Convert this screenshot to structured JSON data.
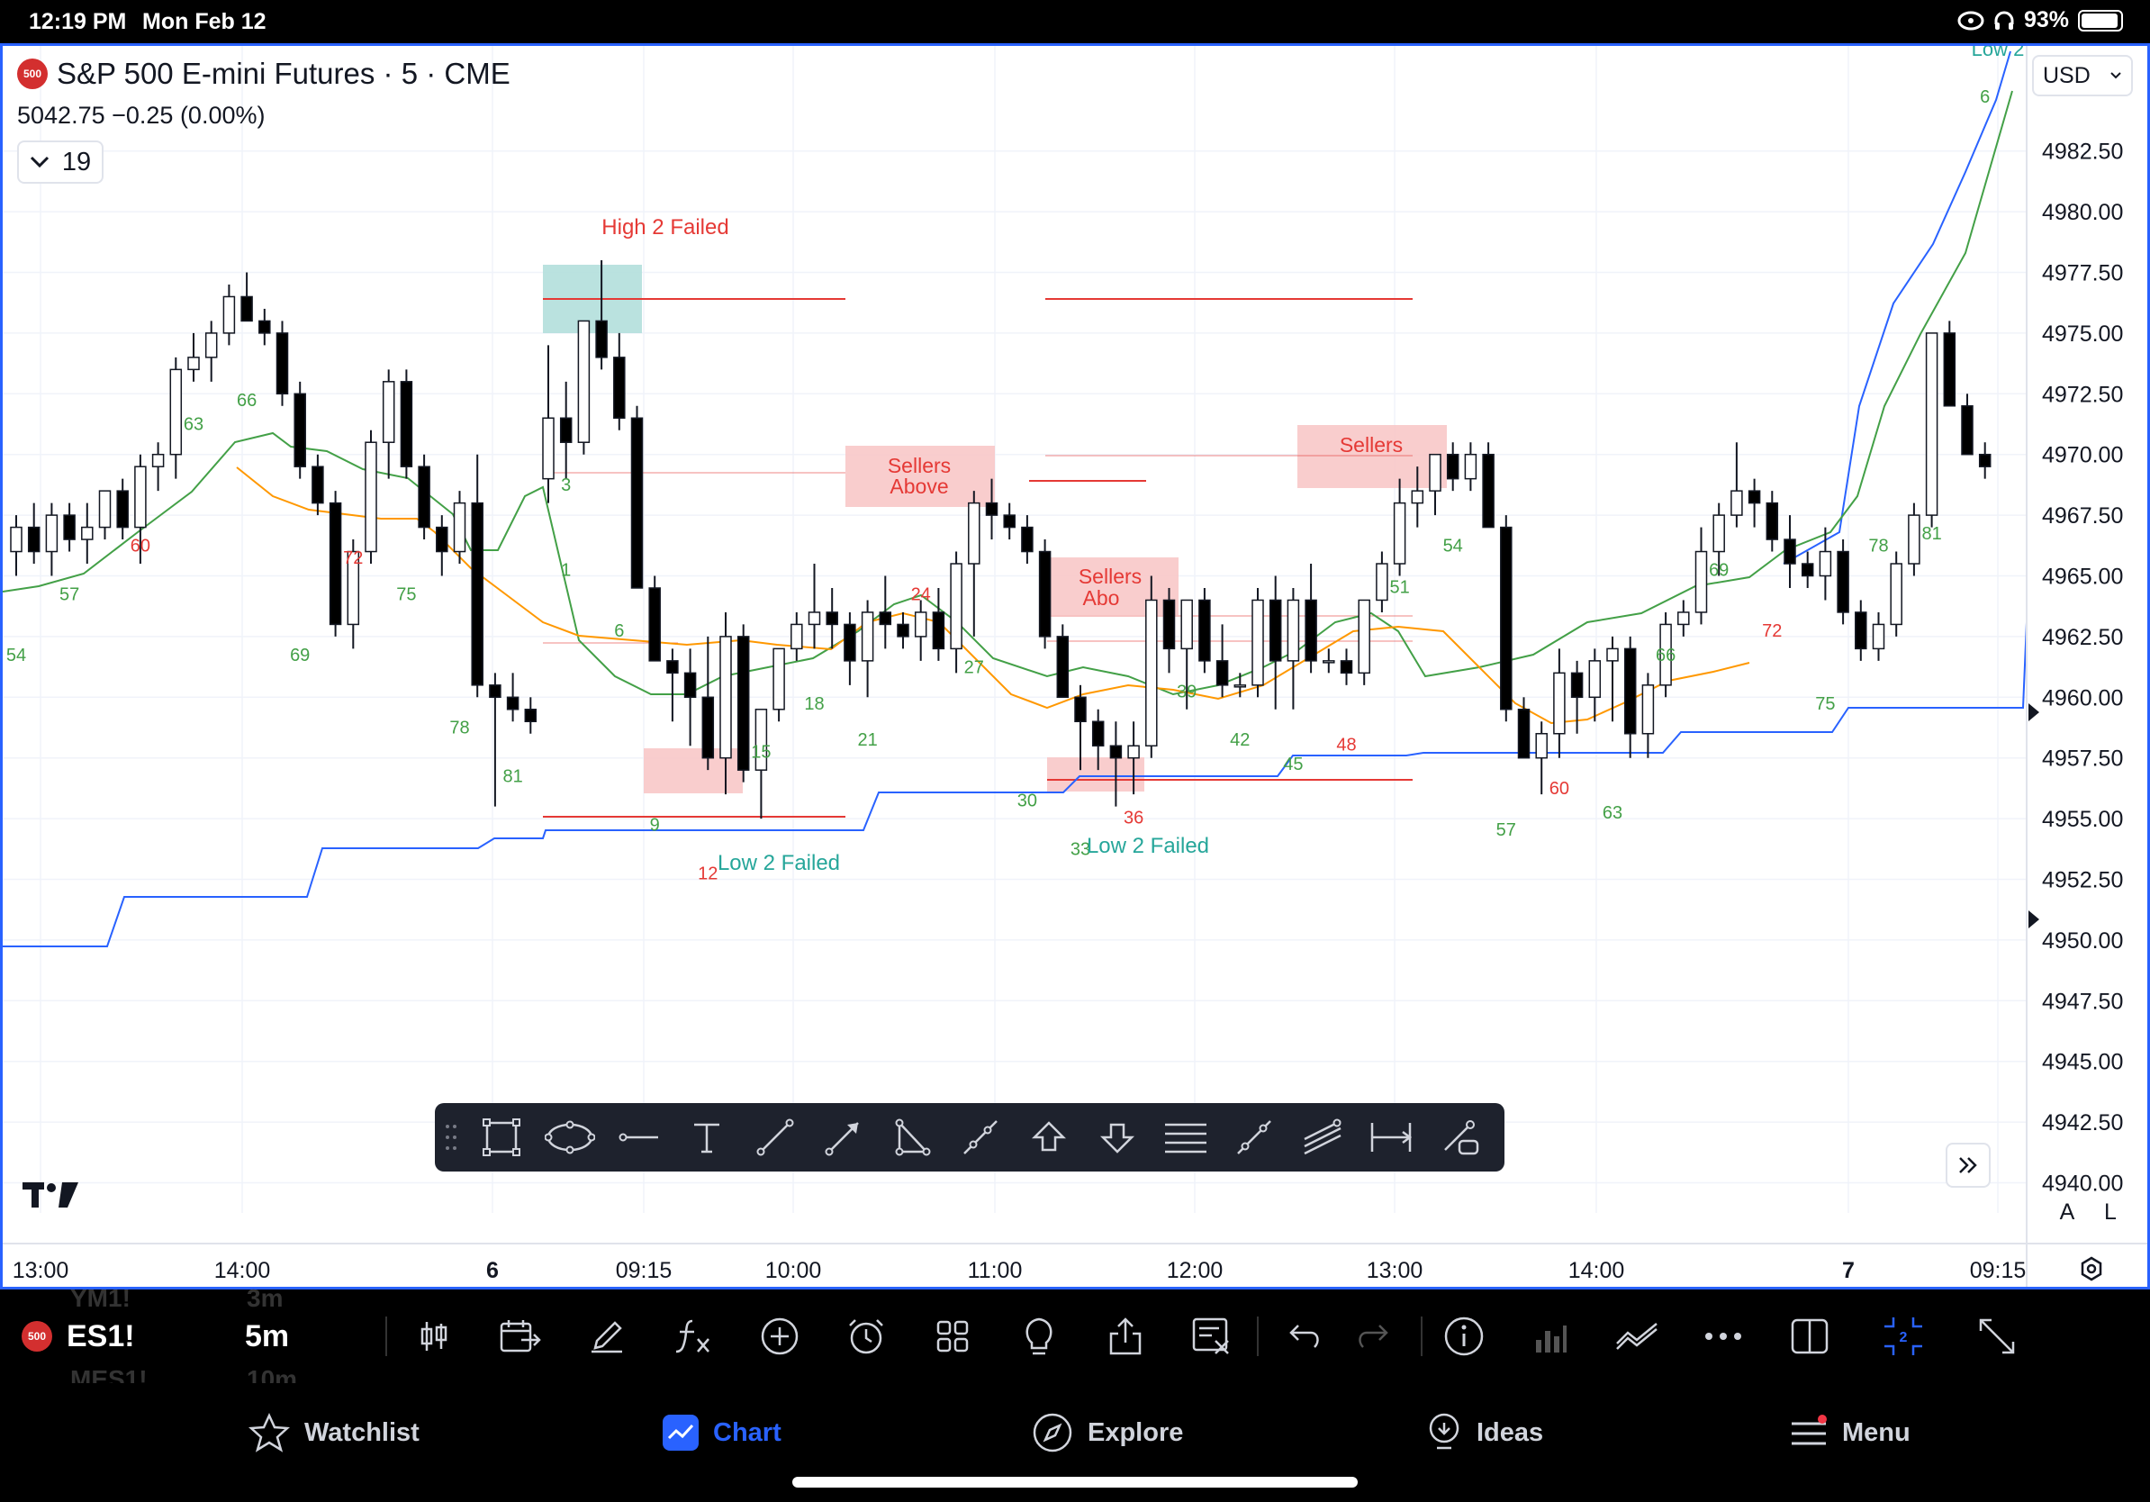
{
  "status": {
    "time": "12:19 PM",
    "date": "Mon Feb 12",
    "battery": "93%"
  },
  "header": {
    "symbol_badge": "500",
    "title": "S&P 500 E-mini Futures · 5 · CME",
    "last": "5042.75",
    "change": "−0.25 (0.00%)",
    "legend_count": "19",
    "currency": "USD"
  },
  "annotations": {
    "high2": "High 2 Failed",
    "sellers": "Sellers",
    "above": "Above",
    "sellers_above_short": "Abo",
    "low2": "Low 2 Failed",
    "low2_edge": "Low 2"
  },
  "chart_data": {
    "type": "candlestick",
    "instrument": "ES1!",
    "interval": "5m",
    "ylim": [
      4938.5,
      4987.5
    ],
    "price_ticks": [
      "4982.50",
      "4980.00",
      "4977.50",
      "4975.00",
      "4972.50",
      "4970.00",
      "4967.50",
      "4965.00",
      "4962.50",
      "4960.00",
      "4957.50",
      "4955.00",
      "4952.50",
      "4950.00",
      "4947.50",
      "4945.00",
      "4942.50",
      "4940.00"
    ],
    "time_ticks": [
      "13:00",
      "14:00",
      "6",
      "09:15",
      "10:00",
      "11:00",
      "12:00",
      "13:00",
      "14:00",
      "7",
      "09:15"
    ],
    "candles": [
      [
        0,
        4966,
        4967.5,
        4965,
        4967
      ],
      [
        1,
        4967,
        4968,
        4965.5,
        4966
      ],
      [
        2,
        4966,
        4968,
        4965,
        4967.5
      ],
      [
        3,
        4967.5,
        4968,
        4966,
        4966.5
      ],
      [
        4,
        4966.5,
        4968,
        4965.5,
        4967
      ],
      [
        5,
        4967,
        4968.5,
        4966.5,
        4968.5
      ],
      [
        6,
        4968.5,
        4969,
        4966.5,
        4967
      ],
      [
        7,
        4967,
        4970,
        4965.5,
        4969.5
      ],
      [
        8,
        4969.5,
        4970.5,
        4968.5,
        4970
      ],
      [
        9,
        4970,
        4974,
        4969,
        4973.5
      ],
      [
        10,
        4973.5,
        4975,
        4973,
        4974
      ],
      [
        11,
        4974,
        4975.5,
        4973,
        4975
      ],
      [
        12,
        4975,
        4977,
        4974.5,
        4976.5
      ],
      [
        13,
        4976.5,
        4977.5,
        4975.5,
        4975.5
      ],
      [
        14,
        4975.5,
        4976,
        4974.5,
        4975
      ],
      [
        15,
        4975,
        4975.5,
        4972,
        4972.5
      ],
      [
        16,
        4972.5,
        4973,
        4969,
        4969.5
      ],
      [
        17,
        4969.5,
        4970,
        4967.5,
        4968
      ],
      [
        18,
        4968,
        4968.5,
        4962.5,
        4963
      ],
      [
        19,
        4963,
        4966.5,
        4962,
        4966
      ],
      [
        20,
        4966,
        4971,
        4965.5,
        4970.5
      ],
      [
        21,
        4970.5,
        4973.5,
        4969,
        4973
      ],
      [
        22,
        4973,
        4973.5,
        4969,
        4969.5
      ],
      [
        23,
        4969.5,
        4970,
        4966.5,
        4967
      ],
      [
        24,
        4967,
        4967.5,
        4965,
        4966
      ],
      [
        25,
        4966,
        4968.5,
        4965.5,
        4968
      ],
      [
        26,
        4968,
        4970,
        4960,
        4960.5
      ],
      [
        27,
        4960.5,
        4961,
        4955.5,
        4960
      ],
      [
        28,
        4960,
        4961,
        4959,
        4959.5
      ],
      [
        29,
        4959.5,
        4960,
        4958.5,
        4959
      ],
      [
        30,
        4969,
        4974.5,
        4968,
        4971.5
      ],
      [
        31,
        4971.5,
        4973,
        4969,
        4970.5
      ],
      [
        32,
        4970.5,
        4975,
        4970,
        4975.5
      ],
      [
        33,
        4975.5,
        4978,
        4973.5,
        4974
      ],
      [
        34,
        4974,
        4975,
        4971,
        4971.5
      ],
      [
        35,
        4971.5,
        4972,
        4964.5,
        4964.5
      ],
      [
        36,
        4964.5,
        4965,
        4961.5,
        4961.5
      ],
      [
        37,
        4961.5,
        4962,
        4959,
        4961
      ],
      [
        38,
        4961,
        4962,
        4958,
        4960
      ],
      [
        39,
        4960,
        4962.5,
        4957,
        4957.5
      ],
      [
        40,
        4957.5,
        4963.5,
        4956,
        4962.5
      ],
      [
        41,
        4962.5,
        4963,
        4956.5,
        4957
      ],
      [
        42,
        4957,
        4959.5,
        4955,
        4959.5
      ],
      [
        43,
        4959.5,
        4962,
        4959,
        4962
      ],
      [
        44,
        4962,
        4963.5,
        4961.5,
        4963
      ],
      [
        45,
        4963,
        4965.5,
        4962,
        4963.5
      ],
      [
        46,
        4963.5,
        4964.5,
        4962,
        4963
      ],
      [
        47,
        4963,
        4963.5,
        4960.5,
        4961.5
      ],
      [
        48,
        4961.5,
        4964,
        4960,
        4963.5
      ],
      [
        49,
        4963.5,
        4965,
        4962,
        4963
      ],
      [
        50,
        4963,
        4963.5,
        4962,
        4962.5
      ],
      [
        51,
        4962.5,
        4964,
        4961.5,
        4963.5
      ],
      [
        52,
        4963.5,
        4964.5,
        4961.5,
        4962
      ],
      [
        53,
        4962,
        4966,
        4961,
        4965.5
      ],
      [
        54,
        4965.5,
        4968.5,
        4962.5,
        4968
      ],
      [
        55,
        4968,
        4969,
        4966.5,
        4967.5
      ],
      [
        56,
        4967.5,
        4968,
        4966.5,
        4967
      ],
      [
        57,
        4967,
        4967.5,
        4965.5,
        4966
      ],
      [
        58,
        4966,
        4966.5,
        4962,
        4962.5
      ],
      [
        59,
        4962.5,
        4963,
        4960,
        4960
      ],
      [
        60,
        4960,
        4960.5,
        4957,
        4959
      ],
      [
        61,
        4959,
        4959.5,
        4957,
        4958
      ],
      [
        62,
        4958,
        4959,
        4955.5,
        4957.5
      ],
      [
        63,
        4957.5,
        4959,
        4956,
        4958
      ],
      [
        64,
        4958,
        4965,
        4957.5,
        4964
      ],
      [
        65,
        4964,
        4964.5,
        4961,
        4962
      ],
      [
        66,
        4962,
        4964,
        4959.5,
        4964
      ],
      [
        67,
        4964,
        4964.5,
        4961,
        4961.5
      ],
      [
        68,
        4961.5,
        4963,
        4960,
        4960.5
      ],
      [
        69,
        4960.5,
        4961,
        4960,
        4960.5
      ],
      [
        70,
        4960.5,
        4964.5,
        4960,
        4964
      ],
      [
        71,
        4964,
        4965,
        4959.5,
        4961.5
      ],
      [
        72,
        4961.5,
        4964.5,
        4959.5,
        4964
      ],
      [
        73,
        4964,
        4965.5,
        4961,
        4961.5
      ],
      [
        74,
        4961.5,
        4962,
        4961,
        4961.5
      ],
      [
        75,
        4961.5,
        4962,
        4960.5,
        4961
      ],
      [
        76,
        4961,
        4964,
        4960.5,
        4964
      ],
      [
        77,
        4964,
        4966,
        4963.5,
        4965.5
      ],
      [
        78,
        4965.5,
        4969,
        4965,
        4968
      ],
      [
        79,
        4968,
        4969.5,
        4967,
        4968.5
      ],
      [
        80,
        4968.5,
        4970,
        4967.5,
        4970
      ],
      [
        81,
        4970,
        4970.5,
        4968.5,
        4969
      ],
      [
        82,
        4969,
        4970.5,
        4968.5,
        4970
      ],
      [
        83,
        4970,
        4970.5,
        4967,
        4967
      ],
      [
        84,
        4967,
        4967.5,
        4959,
        4959.5
      ],
      [
        85,
        4959.5,
        4960,
        4957.5,
        4957.5
      ],
      [
        86,
        4957.5,
        4959,
        4956,
        4958.5
      ],
      [
        87,
        4958.5,
        4962,
        4957.5,
        4961
      ],
      [
        88,
        4961,
        4961.5,
        4958.5,
        4960
      ],
      [
        89,
        4960,
        4962,
        4959,
        4961.5
      ],
      [
        90,
        4961.5,
        4962.5,
        4959,
        4962
      ],
      [
        91,
        4962,
        4962.5,
        4957.5,
        4958.5
      ],
      [
        92,
        4958.5,
        4961,
        4957.5,
        4960.5
      ],
      [
        93,
        4960.5,
        4963.5,
        4960,
        4963
      ],
      [
        94,
        4963,
        4964,
        4962.5,
        4963.5
      ],
      [
        95,
        4963.5,
        4967,
        4963,
        4966
      ],
      [
        96,
        4966,
        4968,
        4965,
        4967.5
      ],
      [
        97,
        4967.5,
        4970.5,
        4967,
        4968.5
      ],
      [
        98,
        4968.5,
        4969,
        4967,
        4968
      ],
      [
        99,
        4968,
        4968.5,
        4966,
        4966.5
      ],
      [
        100,
        4966.5,
        4967.5,
        4964.5,
        4965.5
      ],
      [
        101,
        4965.5,
        4966,
        4964.5,
        4965
      ],
      [
        102,
        4965,
        4967,
        4964,
        4966
      ],
      [
        103,
        4966,
        4966.5,
        4963,
        4963.5
      ],
      [
        104,
        4963.5,
        4964,
        4961.5,
        4962
      ],
      [
        105,
        4962,
        4963.5,
        4961.5,
        4963
      ],
      [
        106,
        4963,
        4966,
        4962.5,
        4965.5
      ],
      [
        107,
        4965.5,
        4968,
        4965,
        4967.5
      ],
      [
        108,
        4967.5,
        4975,
        4967,
        4975
      ],
      [
        109,
        4975,
        4975.5,
        4972,
        4972
      ],
      [
        110,
        4972,
        4972.5,
        4970,
        4970
      ],
      [
        111,
        4970,
        4970.5,
        4969,
        4969.5
      ]
    ],
    "bar_labels": [
      {
        "i": 0,
        "t": "54",
        "c": "g",
        "p": 4961.5
      },
      {
        "i": 3,
        "t": "57",
        "c": "g",
        "p": 4964
      },
      {
        "i": 7,
        "t": "60",
        "c": "r",
        "p": 4966
      },
      {
        "i": 10,
        "t": "63",
        "c": "g",
        "p": 4971
      },
      {
        "i": 13,
        "t": "66",
        "c": "g",
        "p": 4972
      },
      {
        "i": 16,
        "t": "69",
        "c": "g",
        "p": 4961.5
      },
      {
        "i": 19,
        "t": "72",
        "c": "r",
        "p": 4965.5
      },
      {
        "i": 22,
        "t": "75",
        "c": "g",
        "p": 4964
      },
      {
        "i": 25,
        "t": "78",
        "c": "g",
        "p": 4958.5
      },
      {
        "i": 28,
        "t": "81",
        "c": "g",
        "p": 4956.5
      },
      {
        "i": 31,
        "t": "1",
        "c": "g",
        "p": 4965
      },
      {
        "i": 31,
        "t": "3",
        "c": "g",
        "p": 4968.5
      },
      {
        "i": 34,
        "t": "6",
        "c": "g",
        "p": 4962.5
      },
      {
        "i": 36,
        "t": "9",
        "c": "g",
        "p": 4954.5
      },
      {
        "i": 39,
        "t": "12",
        "c": "r",
        "p": 4952.5
      },
      {
        "i": 42,
        "t": "15",
        "c": "g",
        "p": 4957.5
      },
      {
        "i": 45,
        "t": "18",
        "c": "g",
        "p": 4959.5
      },
      {
        "i": 48,
        "t": "21",
        "c": "g",
        "p": 4958
      },
      {
        "i": 51,
        "t": "24",
        "c": "r",
        "p": 4964
      },
      {
        "i": 54,
        "t": "27",
        "c": "g",
        "p": 4961
      },
      {
        "i": 57,
        "t": "30",
        "c": "g",
        "p": 4955.5
      },
      {
        "i": 60,
        "t": "33",
        "c": "g",
        "p": 4953.5
      },
      {
        "i": 63,
        "t": "36",
        "c": "r",
        "p": 4954.8
      },
      {
        "i": 66,
        "t": "39",
        "c": "g",
        "p": 4960
      },
      {
        "i": 69,
        "t": "42",
        "c": "g",
        "p": 4958
      },
      {
        "i": 72,
        "t": "45",
        "c": "g",
        "p": 4957
      },
      {
        "i": 75,
        "t": "48",
        "c": "r",
        "p": 4957.8
      },
      {
        "i": 78,
        "t": "51",
        "c": "g",
        "p": 4964.3
      },
      {
        "i": 81,
        "t": "54",
        "c": "g",
        "p": 4966
      },
      {
        "i": 84,
        "t": "57",
        "c": "g",
        "p": 4954.3
      },
      {
        "i": 87,
        "t": "60",
        "c": "r",
        "p": 4956
      },
      {
        "i": 90,
        "t": "63",
        "c": "g",
        "p": 4955
      },
      {
        "i": 93,
        "t": "66",
        "c": "g",
        "p": 4961.5
      },
      {
        "i": 96,
        "t": "69",
        "c": "g",
        "p": 4965
      },
      {
        "i": 99,
        "t": "72",
        "c": "r",
        "p": 4962.5
      },
      {
        "i": 102,
        "t": "75",
        "c": "g",
        "p": 4959.5
      },
      {
        "i": 105,
        "t": "78",
        "c": "g",
        "p": 4966
      },
      {
        "i": 108,
        "t": "81",
        "c": "g",
        "p": 4966.5
      },
      {
        "i": 111,
        "t": "6",
        "c": "g",
        "p": 4984.5
      }
    ]
  },
  "bottombar": {
    "badge": "500",
    "symbol": "ES1!",
    "interval": "5m",
    "ghost_sym1": "YM1!",
    "ghost_int1": "3m",
    "ghost_sym2": "MES1!",
    "ghost_int2": "10m"
  },
  "nav": {
    "watchlist": "Watchlist",
    "chart": "Chart",
    "explore": "Explore",
    "ideas": "Ideas",
    "menu": "Menu"
  },
  "scale_buttons": {
    "auto": "A",
    "log": "L"
  },
  "colors": {
    "accent": "#2962ff",
    "up": "#ffffff",
    "down": "#000000",
    "green": "#43a047",
    "red": "#e53935",
    "ema": "#ff9800",
    "teal_box": "#b2dfdb",
    "pink_box": "#f8c8c8"
  }
}
